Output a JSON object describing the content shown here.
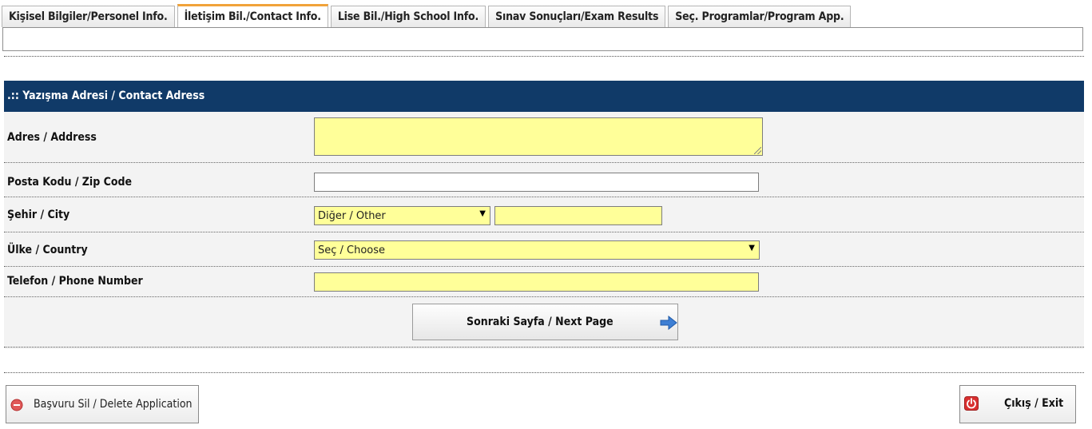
{
  "tabs": [
    {
      "label": "Kişisel Bilgiler/Personel Info.",
      "active": false
    },
    {
      "label": "İletişim Bil./Contact Info.",
      "active": true
    },
    {
      "label": "Lise Bil./High School Info.",
      "active": false
    },
    {
      "label": "Sınav Sonuçları/Exam Results",
      "active": false
    },
    {
      "label": "Seç. Programlar/Program App.",
      "active": false
    }
  ],
  "section": {
    "title": ".:: Yazışma Adresi / Contact Adress"
  },
  "form": {
    "address_label": "Adres / Address",
    "address_value": "",
    "zip_label": "Posta Kodu / Zip Code",
    "zip_value": "",
    "city_label": "Şehir / City",
    "city_selected": "Diğer / Other",
    "city_other_value": "",
    "country_label": "Ülke / Country",
    "country_selected": "Seç / Choose",
    "phone_label": "Telefon / Phone Number",
    "phone_value": ""
  },
  "buttons": {
    "next_label": "Sonraki Sayfa / Next Page",
    "delete_label": "Başvuru Sil / Delete Application",
    "exit_label": "Çıkış / Exit"
  },
  "colors": {
    "header_bg": "#103a68",
    "field_bg": "#ffff99",
    "active_tab_accent": "#f1a33a"
  },
  "icons": {
    "next": "arrow-right-icon",
    "delete": "minus-circle-icon",
    "exit": "power-icon"
  }
}
